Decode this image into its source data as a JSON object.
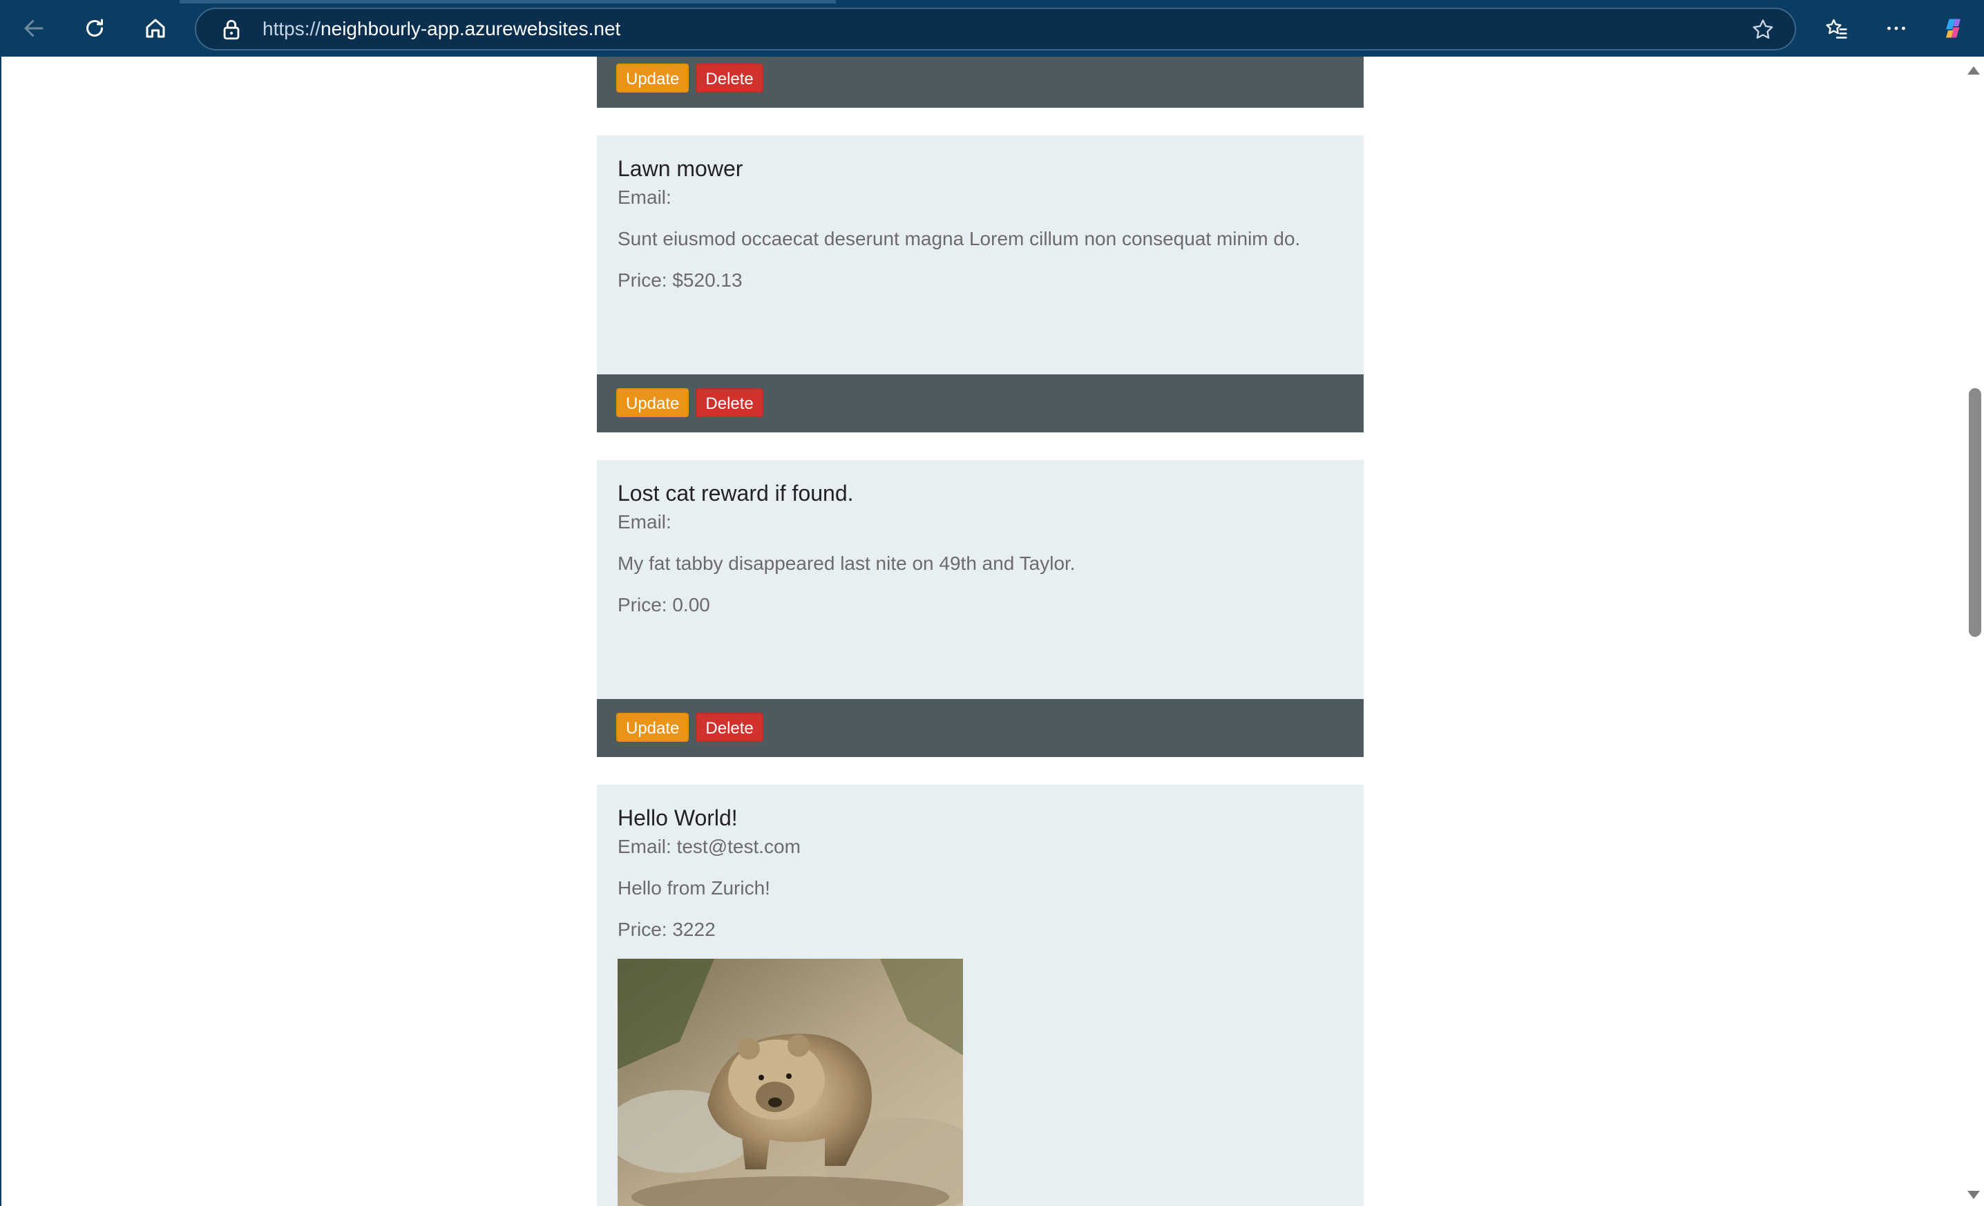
{
  "browser": {
    "url_scheme": "https://",
    "url_host": "neighbourly-app.azurewebsites.net"
  },
  "listings": [
    {
      "update_label": "Update",
      "delete_label": "Delete"
    },
    {
      "title": "Lawn mower",
      "email": "Email:",
      "description": "Sunt eiusmod occaecat deserunt magna Lorem cillum non consequat minim do.",
      "price": "Price: $520.13",
      "update_label": "Update",
      "delete_label": "Delete"
    },
    {
      "title": "Lost cat reward if found.",
      "email": "Email:",
      "description": "My fat tabby disappeared last nite on 49th and Taylor.",
      "price": "Price: 0.00",
      "update_label": "Update",
      "delete_label": "Delete"
    },
    {
      "title": "Hello World!",
      "email": "Email: test@test.com",
      "description": "Hello from Zurich!",
      "price": "Price: 3222",
      "image_icon": "bear-photo"
    }
  ],
  "colors": {
    "card_bg": "#e8eff3",
    "footer_bg": "#4e5b5e",
    "update_btn": "#eb9316",
    "delete_btn": "#d2322d",
    "browser_bar": "#0b3c62"
  }
}
